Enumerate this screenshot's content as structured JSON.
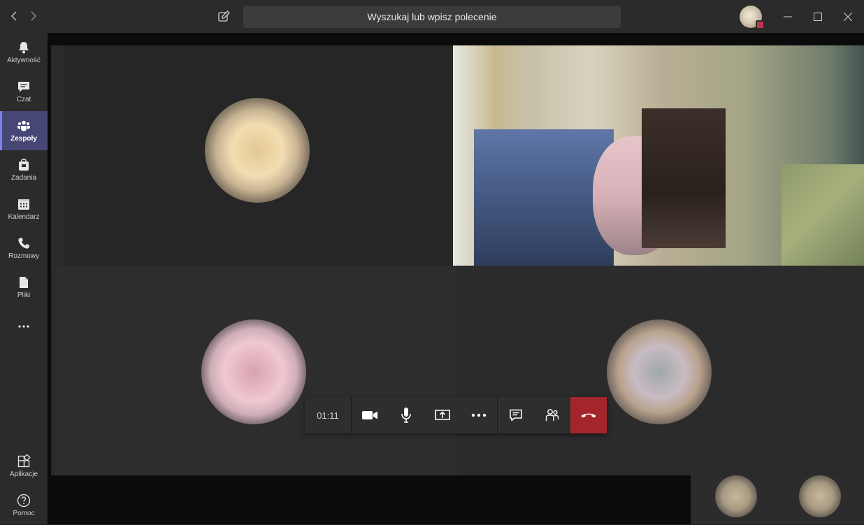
{
  "titlebar": {
    "search_placeholder": "Wyszukaj lub wpisz polecenie"
  },
  "rail": {
    "items": [
      {
        "label": "Aktywność",
        "icon": "bell-icon"
      },
      {
        "label": "Czat",
        "icon": "chat-icon"
      },
      {
        "label": "Zespoły",
        "icon": "teams-icon",
        "active": true
      },
      {
        "label": "Zadania",
        "icon": "briefcase-icon"
      },
      {
        "label": "Kalendarz",
        "icon": "calendar-icon"
      },
      {
        "label": "Rozmowy",
        "icon": "phone-icon"
      },
      {
        "label": "Pliki",
        "icon": "file-icon"
      }
    ],
    "more_icon": "more-icon",
    "bottom": [
      {
        "label": "Aplikacje",
        "icon": "apps-icon"
      },
      {
        "label": "Pomoc",
        "icon": "help-icon"
      }
    ]
  },
  "call": {
    "duration": "01:11"
  },
  "colors": {
    "accent": "#464775",
    "accent_bar": "#7b83eb",
    "hangup": "#a4262c",
    "chrome": "#2b2b2b",
    "stage": "#0b0b0b"
  }
}
